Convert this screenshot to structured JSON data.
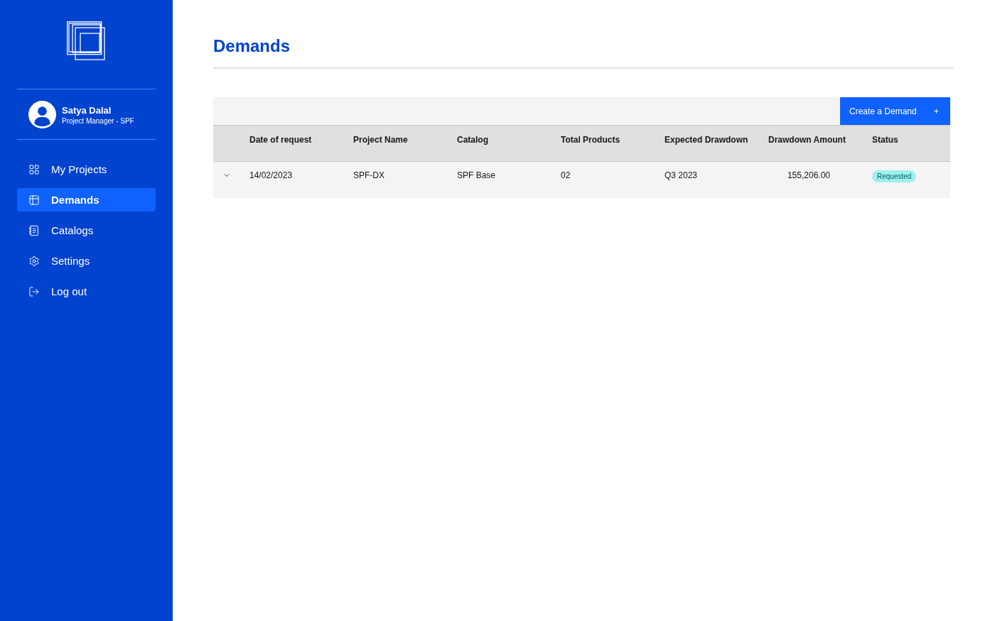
{
  "sidebar": {
    "user": {
      "name": "Satya Dalal",
      "role": "Project Manager - SPF"
    },
    "items": [
      {
        "label": "My Projects",
        "selected": false
      },
      {
        "label": "Demands",
        "selected": true
      },
      {
        "label": "Catalogs",
        "selected": false
      },
      {
        "label": "Settings",
        "selected": false
      },
      {
        "label": "Log out",
        "selected": false
      }
    ]
  },
  "page": {
    "title": "Demands"
  },
  "table": {
    "toolbar": {
      "button": {
        "label": "Create a Demand",
        "symbol": "+"
      }
    },
    "columns": [
      {
        "label": "Date of request",
        "kind": "text"
      },
      {
        "label": "Project Name",
        "kind": "text"
      },
      {
        "label": "Catalog",
        "kind": "text"
      },
      {
        "label": "Total Products",
        "kind": "text"
      },
      {
        "label": "Expected Drawdown",
        "kind": "text"
      },
      {
        "label": "Drawdown Amount",
        "kind": "amount"
      },
      {
        "label": "Status",
        "kind": "status"
      }
    ],
    "rows": [
      {
        "expanded": false,
        "cells": [
          "14/02/2023",
          "SPF-DX",
          "SPF Base",
          "02",
          "Q3 2023",
          "155,206.00"
        ],
        "status": {
          "label": "Requested",
          "color": "#9ef0f0"
        }
      }
    ]
  }
}
